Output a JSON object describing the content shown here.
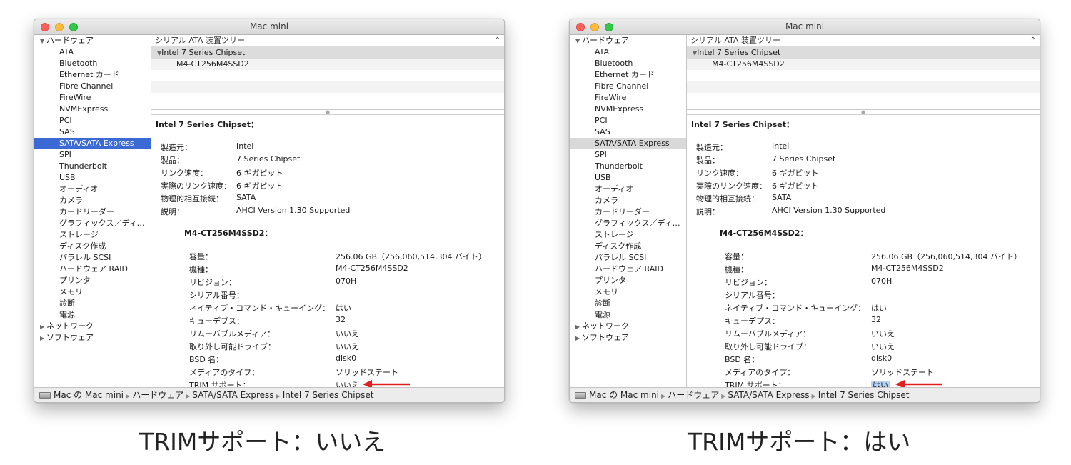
{
  "windows": [
    {
      "title": "Mac mini",
      "sidebar": {
        "hardware_label": "ハードウェア",
        "items": [
          "ATA",
          "Bluetooth",
          "Ethernet カード",
          "Fibre Channel",
          "FireWire",
          "NVMExpress",
          "PCI",
          "SAS",
          "SATA/SATA Express",
          "SPI",
          "Thunderbolt",
          "USB",
          "オーディオ",
          "カメラ",
          "カードリーダー",
          "グラフィックス／ディ…",
          "ストレージ",
          "ディスク作成",
          "パラレル SCSI",
          "ハードウェア RAID",
          "プリンタ",
          "メモリ",
          "診断",
          "電源"
        ],
        "selected_item": "SATA/SATA Express",
        "network_label": "ネットワーク",
        "software_label": "ソフトウェア"
      },
      "tree": {
        "header": "シリアル ATA 装置ツリー",
        "chipset": "Intel 7 Series Chipset",
        "device": "M4-CT256M4SSD2"
      },
      "detail": {
        "chipset_title": "Intel 7 Series Chipset：",
        "chipset_props": [
          {
            "key": "製造元：",
            "value": "Intel"
          },
          {
            "key": "製品：",
            "value": "7 Series Chipset"
          },
          {
            "key": "リンク速度：",
            "value": "6 ギガビット"
          },
          {
            "key": "実際のリンク速度：",
            "value": "6 ギガビット"
          },
          {
            "key": "物理的相互接続：",
            "value": "SATA"
          },
          {
            "key": "説明：",
            "value": "AHCI Version 1.30 Supported"
          }
        ],
        "device_title": "M4-CT256M4SSD2：",
        "device_props": [
          {
            "key": "容量：",
            "value": "256.06 GB（256,060,514,304 バイト）"
          },
          {
            "key": "機種：",
            "value": "M4-CT256M4SSD2"
          },
          {
            "key": "リビジョン：",
            "value": "070H"
          },
          {
            "key": "シリアル番号：",
            "value": ""
          },
          {
            "key": "ネイティブ・コマンド・キューイング：",
            "value": "はい"
          },
          {
            "key": "キューデプス：",
            "value": "32"
          },
          {
            "key": "リムーバブルメディア：",
            "value": "いいえ"
          },
          {
            "key": "取り外し可能ドライブ：",
            "value": "いいえ"
          },
          {
            "key": "BSD 名：",
            "value": "disk0"
          },
          {
            "key": "メディアのタイプ：",
            "value": "ソリッドステート"
          },
          {
            "key": "TRIM サポート：",
            "value": "いいえ"
          }
        ]
      },
      "pathbar": {
        "computer": "Mac の Mac mini",
        "hardware": "ハードウェア",
        "bus": "SATA/SATA Express",
        "chipset": "Intel 7 Series Chipset"
      },
      "caption": "TRIMサポート：いいえ"
    },
    {
      "title": "Mac mini",
      "sidebar": {
        "hardware_label": "ハードウェア",
        "items": [
          "ATA",
          "Bluetooth",
          "Ethernet カード",
          "Fibre Channel",
          "FireWire",
          "NVMExpress",
          "PCI",
          "SAS",
          "SATA/SATA Express",
          "SPI",
          "Thunderbolt",
          "USB",
          "オーディオ",
          "カメラ",
          "カードリーダー",
          "グラフィックス／ディ…",
          "ストレージ",
          "ディスク作成",
          "パラレル SCSI",
          "ハードウェア RAID",
          "プリンタ",
          "メモリ",
          "診断",
          "電源"
        ],
        "selected_item": "SATA/SATA Express",
        "network_label": "ネットワーク",
        "software_label": "ソフトウェア"
      },
      "tree": {
        "header": "シリアル ATA 装置ツリー",
        "chipset": "Intel 7 Series Chipset",
        "device": "M4-CT256M4SSD2"
      },
      "detail": {
        "chipset_title": "Intel 7 Series Chipset：",
        "chipset_props": [
          {
            "key": "製造元：",
            "value": "Intel"
          },
          {
            "key": "製品：",
            "value": "7 Series Chipset"
          },
          {
            "key": "リンク速度：",
            "value": "6 ギガビット"
          },
          {
            "key": "実際のリンク速度：",
            "value": "6 ギガビット"
          },
          {
            "key": "物理的相互接続：",
            "value": "SATA"
          },
          {
            "key": "説明：",
            "value": "AHCI Version 1.30 Supported"
          }
        ],
        "device_title": "M4-CT256M4SSD2：",
        "device_props": [
          {
            "key": "容量：",
            "value": "256.06 GB（256,060,514,304 バイト）"
          },
          {
            "key": "機種：",
            "value": "M4-CT256M4SSD2"
          },
          {
            "key": "リビジョン：",
            "value": "070H"
          },
          {
            "key": "シリアル番号：",
            "value": ""
          },
          {
            "key": "ネイティブ・コマンド・キューイング：",
            "value": "はい"
          },
          {
            "key": "キューデプス：",
            "value": "32"
          },
          {
            "key": "リムーバブルメディア：",
            "value": "いいえ"
          },
          {
            "key": "取り外し可能ドライブ：",
            "value": "いいえ"
          },
          {
            "key": "BSD 名：",
            "value": "disk0"
          },
          {
            "key": "メディアのタイプ：",
            "value": "ソリッドステート"
          },
          {
            "key": "TRIM サポート：",
            "value": "はい"
          }
        ]
      },
      "pathbar": {
        "computer": "Mac の Mac mini",
        "hardware": "ハードウェア",
        "bus": "SATA/SATA Express",
        "chipset": "Intel 7 Series Chipset"
      },
      "caption": "TRIMサポート：はい"
    }
  ],
  "colors": {
    "selection_active": "#3c6ad4",
    "selection_inactive": "#d9d9d9",
    "annotation_arrow": "#e02020",
    "value_highlight": "#b6d2f6"
  }
}
